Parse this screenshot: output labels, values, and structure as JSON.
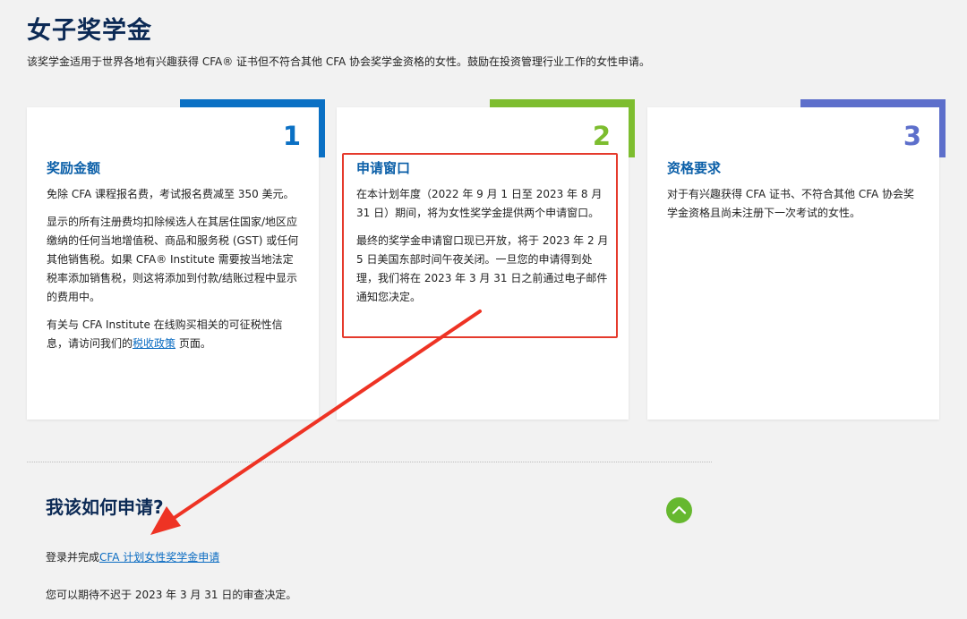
{
  "page": {
    "title": "女子奖学金",
    "intro": "该奖学金适用于世界各地有兴趣获得 CFA® 证书但不符合其他 CFA 协会奖学金资格的女性。鼓励在投资管理行业工作的女性申请。"
  },
  "cards": [
    {
      "number": "1",
      "accent_color": "#0a70c4",
      "heading": "奖励金额",
      "p1": "免除 CFA 课程报名费，考试报名费减至 350 美元。",
      "p2": "显示的所有注册费均扣除候选人在其居住国家/地区应缴纳的任何当地增值税、商品和服务税 (GST) 或任何其他销售税。如果 CFA® Institute 需要按当地法定税率添加销售税，则这将添加到付款/结账过程中显示的费用中。",
      "p3_prefix": "有关与 CFA Institute 在线购买相关的可征税性信息，请访问我们的",
      "p3_link": "税收政策",
      "p3_suffix": "页面。"
    },
    {
      "number": "2",
      "accent_color": "#7dbd2f",
      "heading": "申请窗口",
      "p1": "在本计划年度（2022 年 9 月 1 日至 2023 年 8 月 31 日）期间，将为女性奖学金提供两个申请窗口。",
      "p2": "最终的奖学金申请窗口现已开放，将于 2023 年 2 月 5 日美国东部时间午夜关闭。一旦您的申请得到处理，我们将在 2023 年 3 月 31 日之前通过电子邮件通知您决定。"
    },
    {
      "number": "3",
      "accent_color": "#5d6fcb",
      "heading": "资格要求",
      "p1": "对于有兴趣获得 CFA 证书、不符合其他 CFA 协会奖学金资格且尚未注册下一次考试的女性。"
    }
  ],
  "how": {
    "title": "我该如何申请?",
    "line1_prefix": "登录并完成",
    "line1_link": "CFA 计划女性奖学金申请",
    "line2": "您可以期待不迟于 2023 年 3 月 31 日的审查决定。"
  },
  "annotation": {
    "box_color": "#e53a2c",
    "arrow_color": "#ee3324"
  },
  "icons": {
    "toggle": "chevron-up-icon"
  }
}
